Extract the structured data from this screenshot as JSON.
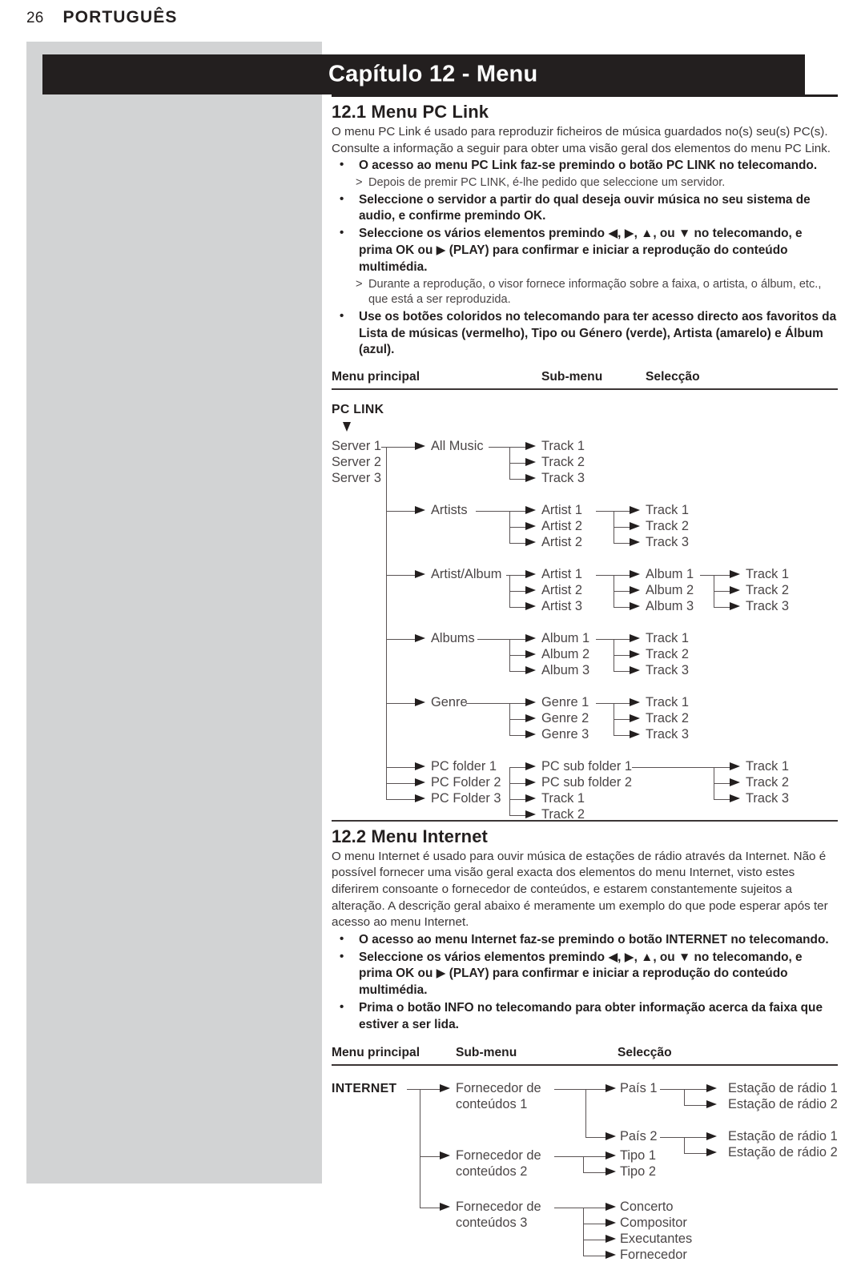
{
  "running_head": {
    "page_number": "26",
    "language": "PORTUGUÊS"
  },
  "chapter_bar": {
    "title": "Capítulo 12 - Menu"
  },
  "section_pc_link": {
    "heading": "12.1 Menu PC Link",
    "intro": "O menu PC Link é usado para reproduzir ficheiros de música guardados no(s) seu(s) PC(s). Consulte a informação a seguir para obter uma visão geral dos elementos do menu PC Link.",
    "bullets": [
      {
        "type": "bullet",
        "text": "O acesso ao menu PC Link faz-se premindo o botão PC LINK no telecomando."
      },
      {
        "type": "sub",
        "text": "Depois de premir PC LINK, é-lhe pedido que seleccione um servidor."
      },
      {
        "type": "bullet",
        "text": "Seleccione o servidor a partir do qual deseja ouvir música no seu sistema de audio, e confirme premindo OK."
      },
      {
        "type": "bullet",
        "text": "Seleccione os vários elementos premindo ◀, ▶, ▲, ou ▼  no telecomando, e prima OK ou ▶ (PLAY) para confirmar e iniciar a reprodução do conteúdo multimédia."
      },
      {
        "type": "sub",
        "text": "Durante a reprodução, o visor fornece informação sobre a faixa, o artista, o álbum, etc., que está a ser reproduzida."
      },
      {
        "type": "bullet",
        "text": "Use os botões coloridos no telecomando para ter acesso directo aos favoritos da Lista de músicas (vermelho), Tipo ou Género (verde), Artista (amarelo) e Álbum (azul)."
      }
    ],
    "table_headers": [
      "Menu principal",
      "Sub-menu",
      "Selecção"
    ],
    "root_label": "PC LINK",
    "servers": [
      "Server 1",
      "Server 2",
      "Server 3"
    ],
    "branches": [
      {
        "label": "All Music",
        "children": [
          "Track 1",
          "Track 2",
          "Track 3"
        ]
      },
      {
        "label": "Artists",
        "children": [
          "Artist 1",
          "Artist 2",
          "Artist 2"
        ],
        "grandchildren": [
          "Track 1",
          "Track 2",
          "Track 3"
        ]
      },
      {
        "label": "Artist/Album",
        "children": [
          "Artist 1",
          "Artist 2",
          "Artist 3"
        ],
        "grandchildren": [
          "Album 1",
          "Album 2",
          "Album 3"
        ],
        "greatgrandchildren": [
          "Track 1",
          "Track 2",
          "Track 3"
        ]
      },
      {
        "label": "Albums",
        "children": [
          "Album 1",
          "Album 2",
          "Album 3"
        ],
        "grandchildren": [
          "Track 1",
          "Track 2",
          "Track 3"
        ]
      },
      {
        "label": "Genre",
        "children": [
          "Genre 1",
          "Genre 2",
          "Genre 3"
        ],
        "grandchildren": [
          "Track 1",
          "Track 2",
          "Track 3"
        ]
      }
    ],
    "pc_folders": [
      "PC folder 1",
      "PC Folder 2",
      "PC Folder 3"
    ],
    "pc_sub_folders": [
      "PC sub folder 1",
      "PC sub folder 2",
      "Track 1",
      "Track 2"
    ],
    "pc_folder_tracks": [
      "Track 1",
      "Track 2",
      "Track 3"
    ]
  },
  "section_internet": {
    "heading": "12.2 Menu Internet",
    "intro": "O menu Internet é usado para ouvir música de estações de rádio através da Internet. Não é possível fornecer uma visão geral exacta dos elementos do menu Internet, visto estes diferirem consoante o fornecedor de conteúdos, e estarem constantemente sujeitos a alteração. A descrição geral abaixo é meramente um exemplo do que pode esperar após ter acesso ao menu Internet.",
    "bullets": [
      {
        "type": "bullet",
        "text": "O acesso ao menu Internet faz-se premindo o botão INTERNET no telecomando."
      },
      {
        "type": "bullet",
        "text": "Seleccione os vários elementos premindo ◀, ▶, ▲, ou ▼ no telecomando, e prima OK ou ▶ (PLAY) para confirmar e iniciar a reprodução do conteúdo multimédia."
      },
      {
        "type": "bullet",
        "text": "Prima o botão INFO no telecomando para obter informação acerca da faixa que estiver a ser lida."
      }
    ],
    "table_headers": [
      "Menu principal",
      "Sub-menu",
      "Selecção"
    ],
    "root_label": "INTERNET",
    "providers": [
      {
        "label_line1": "Fornecedor de",
        "label_line2": "conteúdos 1",
        "children": [
          {
            "label": "País 1",
            "stations": [
              "Estação de rádio 1",
              "Estação de rádio 2"
            ]
          },
          {
            "label": "País 2",
            "stations": [
              "Estação de rádio 1",
              "Estação de rádio 2"
            ]
          }
        ]
      },
      {
        "label_line1": "Fornecedor de",
        "label_line2": "conteúdos 2",
        "children": [
          {
            "label": "Tipo 1"
          },
          {
            "label": "Tipo 2"
          }
        ]
      },
      {
        "label_line1": "Fornecedor de",
        "label_line2": "conteúdos 3",
        "children": [
          {
            "label": "Concerto"
          },
          {
            "label": "Compositor"
          },
          {
            "label": "Executantes"
          },
          {
            "label": "Fornecedor"
          }
        ]
      }
    ]
  },
  "colors": {
    "bar": "#231f1f",
    "panel": "#d2d3d4",
    "text": "#231f1f",
    "muted": "#4a4546"
  }
}
